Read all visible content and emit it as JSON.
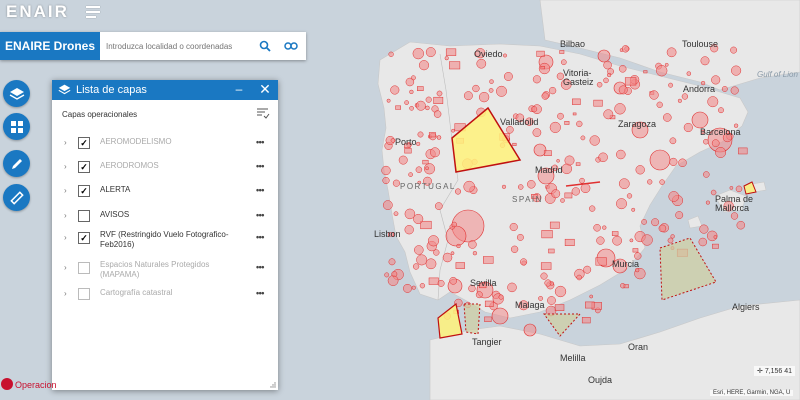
{
  "brand": {
    "logo_text": "ENAIR"
  },
  "search": {
    "app_name": "ENAIRE Drones",
    "placeholder": "Introduzca localidad o coordenadas",
    "search_icon": "search-icon",
    "link_icon": "link-icon"
  },
  "toolbar": {
    "buttons": [
      {
        "icon": "layers-icon"
      },
      {
        "icon": "grid-icon"
      },
      {
        "icon": "pencil-icon"
      },
      {
        "icon": "ruler-icon"
      }
    ]
  },
  "layer_panel": {
    "title": "Lista de capas",
    "minimize_label": "–",
    "close_label": "✕",
    "section_label": "Capas operacionales",
    "layers": [
      {
        "name": "AEROMODELISMO",
        "checked": true,
        "dim": true
      },
      {
        "name": "AERODROMOS",
        "checked": true,
        "dim": true
      },
      {
        "name": "ALERTA",
        "checked": true,
        "dim": false
      },
      {
        "name": "AVISOS",
        "checked": false,
        "dim": false
      },
      {
        "name": "RVF (Restringido Vuelo Fotografico-Feb2016)",
        "checked": true,
        "dim": false
      },
      {
        "name": "Espacios Naturales Protegidos (MAPAMA)",
        "checked": false,
        "dim": true
      },
      {
        "name": "Cartografía catastral",
        "checked": false,
        "dim": true
      }
    ],
    "more_label": "•••"
  },
  "map": {
    "labels": [
      {
        "text": "Oviedo",
        "kind": "city"
      },
      {
        "text": "Bilbao",
        "kind": "city"
      },
      {
        "text": "Vitoria-\nGasteiz",
        "kind": "city"
      },
      {
        "text": "Toulouse",
        "kind": "city"
      },
      {
        "text": "Gulf of Lion",
        "kind": "sea"
      },
      {
        "text": "Andorra",
        "kind": "city"
      },
      {
        "text": "Valladolid",
        "kind": "city"
      },
      {
        "text": "Zaragoza",
        "kind": "city"
      },
      {
        "text": "Porto",
        "kind": "city"
      },
      {
        "text": "Barcelona",
        "kind": "city"
      },
      {
        "text": "PORTUGAL",
        "kind": "country"
      },
      {
        "text": "Madrid",
        "kind": "city"
      },
      {
        "text": "SPAIN",
        "kind": "country"
      },
      {
        "text": "Palma de\nMallorca",
        "kind": "city"
      },
      {
        "text": "Lisbon",
        "kind": "city"
      },
      {
        "text": "Murcia",
        "kind": "city"
      },
      {
        "text": "Sevilla",
        "kind": "city"
      },
      {
        "text": "Algiers",
        "kind": "city"
      },
      {
        "text": "Malaga",
        "kind": "city"
      },
      {
        "text": "Tangier",
        "kind": "city"
      },
      {
        "text": "Oran",
        "kind": "city"
      },
      {
        "text": "Melilla",
        "kind": "city"
      },
      {
        "text": "Oujda",
        "kind": "city"
      }
    ],
    "colors": {
      "sea": "#c9d3dc",
      "land": "#e8e8e8",
      "restricted_fill": "#f28b8b",
      "restricted_stroke": "#e03030",
      "alert_fill": "#fff27a",
      "rvf_fill": "#cfcfa0"
    }
  },
  "bottom": {
    "operations_label": "Operacion",
    "coordinates": "7,156 41",
    "attribution": "Esri, HERE, Garmin, NGA, U"
  },
  "colors": {
    "accent": "#1a78c2",
    "brand_red": "#c8102e"
  }
}
